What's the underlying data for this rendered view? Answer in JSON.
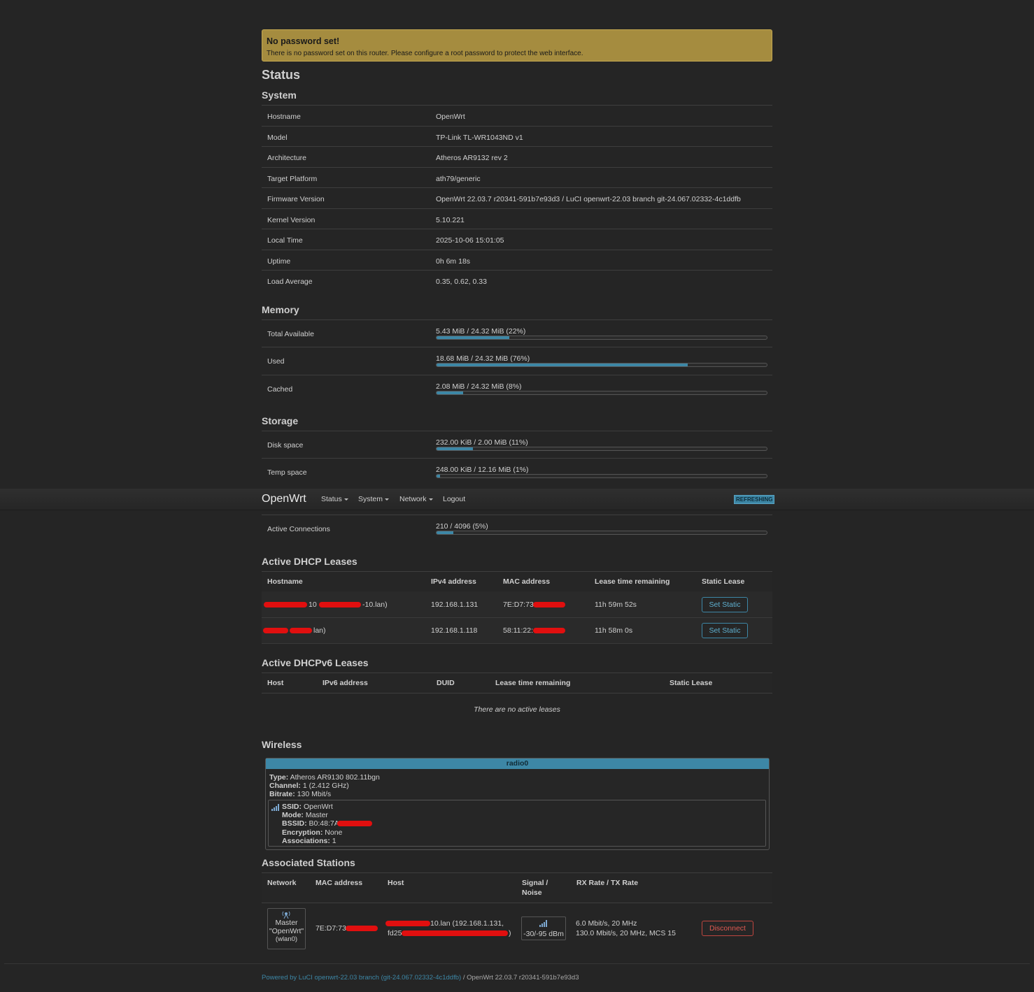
{
  "alert": {
    "title": "No password set!",
    "text": "There is no password set on this router. Please configure a root password to protect the web interface."
  },
  "page_title": "Status",
  "system": {
    "title": "System",
    "rows": [
      {
        "k": "Hostname",
        "v": "OpenWrt"
      },
      {
        "k": "Model",
        "v": "TP-Link TL-WR1043ND v1"
      },
      {
        "k": "Architecture",
        "v": "Atheros AR9132 rev 2"
      },
      {
        "k": "Target Platform",
        "v": "ath79/generic"
      },
      {
        "k": "Firmware Version",
        "v": "OpenWrt 22.03.7 r20341-591b7e93d3 / LuCI openwrt-22.03 branch git-24.067.02332-4c1ddfb"
      },
      {
        "k": "Kernel Version",
        "v": "5.10.221"
      },
      {
        "k": "Local Time",
        "v": "2025-10-06 15:01:05"
      },
      {
        "k": "Uptime",
        "v": "0h 6m 18s"
      },
      {
        "k": "Load Average",
        "v": "0.35, 0.62, 0.33"
      }
    ]
  },
  "memory": {
    "title": "Memory",
    "rows": [
      {
        "k": "Total Available",
        "v": "5.43 MiB / 24.32 MiB (22%)",
        "fill": 0.22
      },
      {
        "k": "Used",
        "v": "18.68 MiB / 24.32 MiB (76%)",
        "fill": 0.76
      },
      {
        "k": "Cached",
        "v": "2.08 MiB / 24.32 MiB (8%)",
        "fill": 0.08
      }
    ]
  },
  "storage": {
    "title": "Storage",
    "rows": [
      {
        "k": "Disk space",
        "v": "232.00 KiB / 2.00 MiB (11%)",
        "fill": 0.11
      },
      {
        "k": "Temp space",
        "v": "248.00 KiB / 12.16 MiB (1%)",
        "fill": 0.01
      }
    ]
  },
  "navbar": {
    "brand": "OpenWrt",
    "items": [
      "Status",
      "System",
      "Network"
    ],
    "logout": "Logout",
    "badge": "REFRESHING"
  },
  "connections": {
    "k": "Active Connections",
    "v": "210 / 4096 (5%)",
    "fill": 0.05
  },
  "dhcp": {
    "title": "Active DHCP Leases",
    "headers": [
      "Hostname",
      "IPv4 address",
      "MAC address",
      "Lease time remaining",
      "Static Lease"
    ],
    "rows": [
      {
        "host_a": "10",
        "host_b": "-10.lan)",
        "ip": "192.168.1.131",
        "mac": "7E:D7:73",
        "lease": "11h 59m 52s",
        "btn": "Set Static"
      },
      {
        "host_a": "",
        "host_b": "lan)",
        "ip": "192.168.1.118",
        "mac": "58:11:22:",
        "lease": "11h 58m 0s",
        "btn": "Set Static"
      }
    ]
  },
  "dhcp6": {
    "title": "Active DHCPv6 Leases",
    "headers": [
      "Host",
      "IPv6 address",
      "DUID",
      "Lease time remaining",
      "Static Lease"
    ],
    "empty": "There are no active leases"
  },
  "wireless": {
    "title": "Wireless",
    "radio": "radio0",
    "type_label": "Type:",
    "type": "Atheros AR9130 802.11bgn",
    "channel_label": "Channel:",
    "channel": "1 (2.412 GHz)",
    "bitrate_label": "Bitrate:",
    "bitrate": "130 Mbit/s",
    "ssid_label": "SSID:",
    "ssid": "OpenWrt",
    "mode_label": "Mode:",
    "mode": "Master",
    "bssid_label": "BSSID:",
    "bssid": "B0:48:7A",
    "enc_label": "Encryption:",
    "enc": "None",
    "assoc_label": "Associations:",
    "assoc": "1"
  },
  "stations": {
    "title": "Associated Stations",
    "headers": {
      "network": "Network",
      "mac": "MAC address",
      "host": "Host",
      "signal1": "Signal /",
      "signal2": "Noise",
      "rate": "RX Rate / TX Rate"
    },
    "row": {
      "net1": "Master",
      "net2": "\"OpenWrt\"",
      "net3": "(wlan0)",
      "mac": "7E:D7:73",
      "host1": "10.lan (192.168.1.131,",
      "host2a": "fd25",
      "host2b": ")",
      "signal": "-30/-95 dBm",
      "rx": "6.0 Mbit/s, 20 MHz",
      "tx": "130.0 Mbit/s, 20 MHz, MCS 15",
      "btn": "Disconnect"
    }
  },
  "footer": {
    "link": "Powered by LuCI openwrt-22.03 branch (git-24.067.02332-4c1ddfb)",
    "rest": " / OpenWrt 22.03.7 r20341-591b7e93d3"
  }
}
